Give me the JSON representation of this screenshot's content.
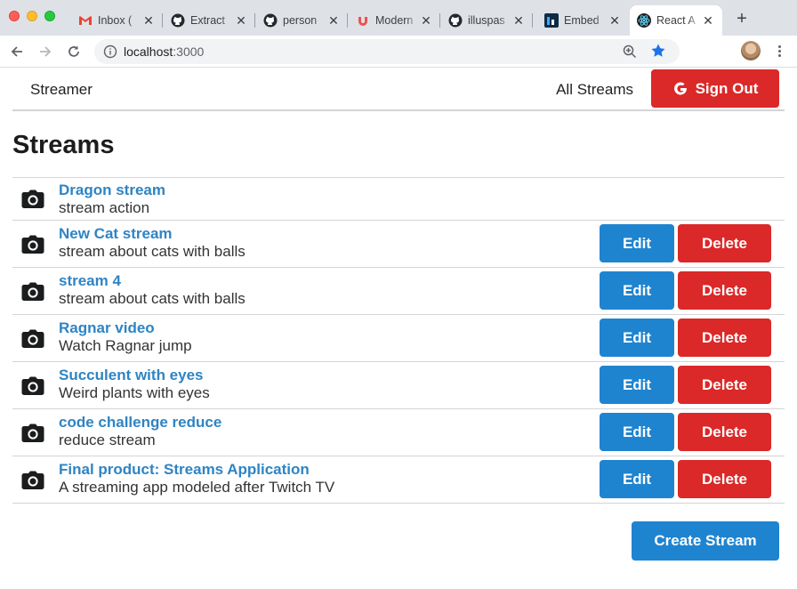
{
  "browser": {
    "tabs": [
      {
        "title": "Inbox (",
        "icon": "gmail-icon"
      },
      {
        "title": "Extract",
        "icon": "github-icon"
      },
      {
        "title": "person",
        "icon": "github-icon"
      },
      {
        "title": "Modern",
        "icon": "udemy-icon"
      },
      {
        "title": "illuspas",
        "icon": "github-icon"
      },
      {
        "title": "Embed",
        "icon": "app-icon"
      },
      {
        "title": "React A",
        "icon": "react-icon",
        "active": true
      }
    ],
    "url_host": "localhost",
    "url_port": ":3000"
  },
  "header": {
    "brand": "Streamer",
    "all_streams": "All Streams",
    "sign_out": "Sign Out"
  },
  "page_title": "Streams",
  "streams": [
    {
      "title": "Dragon stream",
      "description": "stream action",
      "owned": false
    },
    {
      "title": "New Cat stream",
      "description": "stream about cats with balls",
      "owned": true
    },
    {
      "title": "stream 4",
      "description": "stream about cats with balls",
      "owned": true
    },
    {
      "title": "Ragnar video",
      "description": "Watch Ragnar jump",
      "owned": true
    },
    {
      "title": "Succulent with eyes",
      "description": "Weird plants with eyes",
      "owned": true
    },
    {
      "title": "code challenge reduce",
      "description": "reduce stream",
      "owned": true
    },
    {
      "title": "Final product: Streams Application",
      "description": "A streaming app modeled after Twitch TV",
      "owned": true
    }
  ],
  "actions": {
    "edit": "Edit",
    "delete": "Delete",
    "create": "Create Stream"
  },
  "colors": {
    "primary": "#1f84d0",
    "danger": "#db2828",
    "link": "#2e84c3"
  }
}
